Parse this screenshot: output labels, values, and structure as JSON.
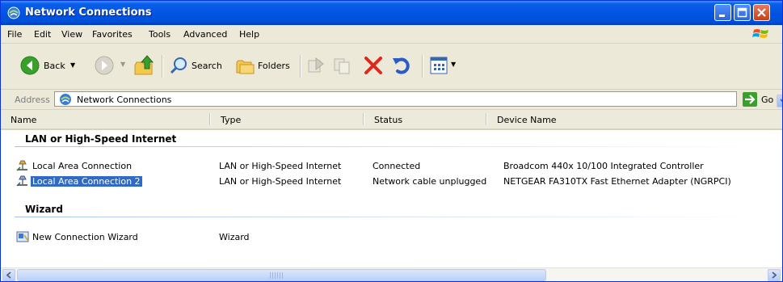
{
  "window": {
    "title": "Network Connections"
  },
  "menu": [
    "File",
    "Edit",
    "View",
    "Favorites",
    "Tools",
    "Advanced",
    "Help"
  ],
  "toolbar": {
    "back": "Back",
    "search": "Search",
    "folders": "Folders"
  },
  "address": {
    "label": "Address",
    "value": "Network Connections",
    "go": "Go"
  },
  "columns": [
    "Name",
    "Type",
    "Status",
    "Device Name"
  ],
  "groups": [
    {
      "label": "LAN or High-Speed Internet"
    },
    {
      "label": "Wizard"
    }
  ],
  "rows": [
    {
      "name": "Local Area Connection",
      "type": "LAN or High-Speed Internet",
      "status": "Connected",
      "device": "Broadcom 440x 10/100 Integrated Controller",
      "selected": false
    },
    {
      "name": "Local Area Connection 2",
      "type": "LAN or High-Speed Internet",
      "status": "Network cable unplugged",
      "device": "NETGEAR FA310TX Fast Ethernet Adapter (NGRPCI)",
      "selected": true
    },
    {
      "name": "New Connection Wizard",
      "type": "Wizard",
      "status": "",
      "device": "",
      "selected": false
    }
  ],
  "icons": {
    "title": "network-connections-icon",
    "back": "back-arrow-icon",
    "forward": "forward-arrow-icon",
    "up": "up-folder-icon",
    "search": "search-magnifier-icon",
    "folders": "folders-icon",
    "move": "move-to-icon",
    "copy": "copy-to-icon",
    "delete": "delete-x-icon",
    "undo": "undo-icon",
    "views": "views-icon",
    "lan": "lan-connection-icon",
    "wizard": "wizard-icon",
    "go": "go-arrow-icon"
  },
  "colors": {
    "titlebar": "#0053e1",
    "selection": "#316ac5",
    "close": "#c93f17",
    "go": "#3a9f2b",
    "delete": "#e0281a"
  }
}
